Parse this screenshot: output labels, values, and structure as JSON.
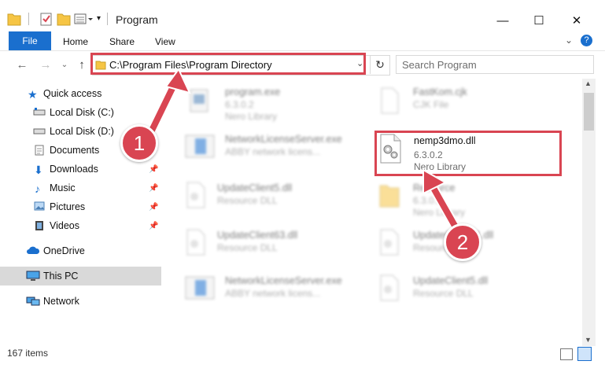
{
  "window": {
    "title": "Program",
    "minimize": "—",
    "maximize": "☐",
    "close": "✕"
  },
  "ribbon": {
    "file": "File",
    "home": "Home",
    "share": "Share",
    "view": "View"
  },
  "address": {
    "path": "C:\\Program Files\\Program Directory",
    "search_placeholder": "Search Program"
  },
  "sidebar": {
    "items": [
      {
        "label": "Quick access",
        "icon": "star-icon"
      },
      {
        "label": "Local Disk (C:)",
        "icon": "drive-icon"
      },
      {
        "label": "Local Disk (D:)",
        "icon": "drive-icon"
      },
      {
        "label": "Documents",
        "icon": "documents-icon"
      },
      {
        "label": "Downloads",
        "icon": "downloads-icon"
      },
      {
        "label": "Music",
        "icon": "music-icon"
      },
      {
        "label": "Pictures",
        "icon": "pictures-icon"
      },
      {
        "label": "Videos",
        "icon": "videos-icon"
      },
      {
        "label": "OneDrive",
        "icon": "cloud-icon"
      },
      {
        "label": "This PC",
        "icon": "computer-icon"
      },
      {
        "label": "Network",
        "icon": "network-icon"
      }
    ]
  },
  "files": [
    {
      "name": "program.exe",
      "sub": "6.3.0.2",
      "sub2": "Nero Library"
    },
    {
      "name": "FastKom.cjk",
      "sub": "CJK File"
    },
    {
      "name": "NetworkLicenseServer.exe",
      "sub": "ABBY network licens..."
    },
    {
      "name": "nemp3dmo.dll",
      "sub": "6.3.0.2",
      "sub2": "Nero Library"
    },
    {
      "name": "UpdateClient5.dll",
      "sub": "Resource DLL"
    },
    {
      "name": "Resource",
      "sub": "6.3.0.2",
      "sub2": "Nero Library"
    },
    {
      "name": "UpdateClient63.dll",
      "sub": "Resource DLL"
    },
    {
      "name": "UpdateClient21.dll",
      "sub": "Resource DLL"
    },
    {
      "name": "NetworkLicenseServer.exe",
      "sub": "ABBY network licens..."
    },
    {
      "name": "UpdateClient5.dll",
      "sub": "Resource DLL"
    }
  ],
  "status": {
    "items": "167 items"
  },
  "annotations": {
    "one": "1",
    "two": "2",
    "color": "#d94552"
  }
}
